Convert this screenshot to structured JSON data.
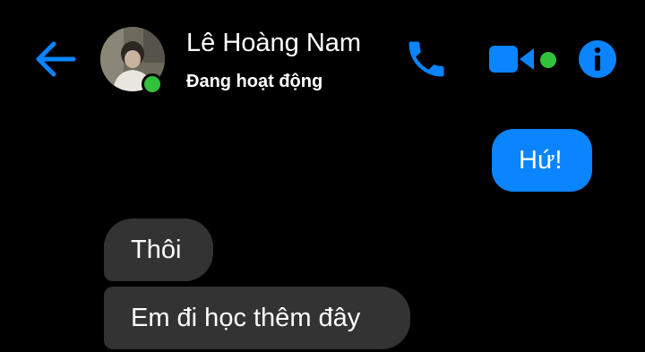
{
  "header": {
    "contact_name": "Lê Hoàng Nam",
    "status_text": "Đang hoạt động",
    "icons": {
      "back": "arrow-left-icon",
      "call": "phone-icon",
      "video": "video-camera-icon",
      "info": "info-icon"
    }
  },
  "messages": [
    {
      "sender": "me",
      "text": "Hứ!"
    },
    {
      "sender": "contact",
      "text": "Thôi"
    },
    {
      "sender": "contact",
      "text": "Em đi học thêm đây"
    }
  ],
  "colors": {
    "accent": "#0a84ff",
    "online": "#31c13a",
    "incoming_bubble": "#333333",
    "background": "#000000"
  }
}
